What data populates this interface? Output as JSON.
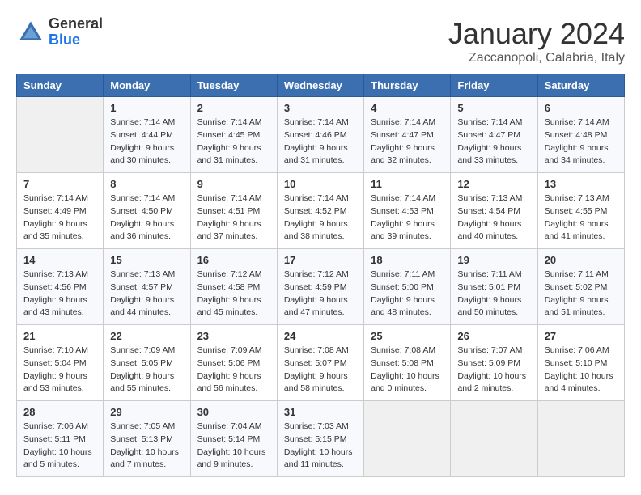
{
  "header": {
    "logo": {
      "general": "General",
      "blue": "Blue"
    },
    "title": "January 2024",
    "location": "Zaccanopoli, Calabria, Italy"
  },
  "weekdays": [
    "Sunday",
    "Monday",
    "Tuesday",
    "Wednesday",
    "Thursday",
    "Friday",
    "Saturday"
  ],
  "weeks": [
    [
      {
        "day": "",
        "info": ""
      },
      {
        "day": "1",
        "info": "Sunrise: 7:14 AM\nSunset: 4:44 PM\nDaylight: 9 hours\nand 30 minutes."
      },
      {
        "day": "2",
        "info": "Sunrise: 7:14 AM\nSunset: 4:45 PM\nDaylight: 9 hours\nand 31 minutes."
      },
      {
        "day": "3",
        "info": "Sunrise: 7:14 AM\nSunset: 4:46 PM\nDaylight: 9 hours\nand 31 minutes."
      },
      {
        "day": "4",
        "info": "Sunrise: 7:14 AM\nSunset: 4:47 PM\nDaylight: 9 hours\nand 32 minutes."
      },
      {
        "day": "5",
        "info": "Sunrise: 7:14 AM\nSunset: 4:47 PM\nDaylight: 9 hours\nand 33 minutes."
      },
      {
        "day": "6",
        "info": "Sunrise: 7:14 AM\nSunset: 4:48 PM\nDaylight: 9 hours\nand 34 minutes."
      }
    ],
    [
      {
        "day": "7",
        "info": "Sunrise: 7:14 AM\nSunset: 4:49 PM\nDaylight: 9 hours\nand 35 minutes."
      },
      {
        "day": "8",
        "info": "Sunrise: 7:14 AM\nSunset: 4:50 PM\nDaylight: 9 hours\nand 36 minutes."
      },
      {
        "day": "9",
        "info": "Sunrise: 7:14 AM\nSunset: 4:51 PM\nDaylight: 9 hours\nand 37 minutes."
      },
      {
        "day": "10",
        "info": "Sunrise: 7:14 AM\nSunset: 4:52 PM\nDaylight: 9 hours\nand 38 minutes."
      },
      {
        "day": "11",
        "info": "Sunrise: 7:14 AM\nSunset: 4:53 PM\nDaylight: 9 hours\nand 39 minutes."
      },
      {
        "day": "12",
        "info": "Sunrise: 7:13 AM\nSunset: 4:54 PM\nDaylight: 9 hours\nand 40 minutes."
      },
      {
        "day": "13",
        "info": "Sunrise: 7:13 AM\nSunset: 4:55 PM\nDaylight: 9 hours\nand 41 minutes."
      }
    ],
    [
      {
        "day": "14",
        "info": "Sunrise: 7:13 AM\nSunset: 4:56 PM\nDaylight: 9 hours\nand 43 minutes."
      },
      {
        "day": "15",
        "info": "Sunrise: 7:13 AM\nSunset: 4:57 PM\nDaylight: 9 hours\nand 44 minutes."
      },
      {
        "day": "16",
        "info": "Sunrise: 7:12 AM\nSunset: 4:58 PM\nDaylight: 9 hours\nand 45 minutes."
      },
      {
        "day": "17",
        "info": "Sunrise: 7:12 AM\nSunset: 4:59 PM\nDaylight: 9 hours\nand 47 minutes."
      },
      {
        "day": "18",
        "info": "Sunrise: 7:11 AM\nSunset: 5:00 PM\nDaylight: 9 hours\nand 48 minutes."
      },
      {
        "day": "19",
        "info": "Sunrise: 7:11 AM\nSunset: 5:01 PM\nDaylight: 9 hours\nand 50 minutes."
      },
      {
        "day": "20",
        "info": "Sunrise: 7:11 AM\nSunset: 5:02 PM\nDaylight: 9 hours\nand 51 minutes."
      }
    ],
    [
      {
        "day": "21",
        "info": "Sunrise: 7:10 AM\nSunset: 5:04 PM\nDaylight: 9 hours\nand 53 minutes."
      },
      {
        "day": "22",
        "info": "Sunrise: 7:09 AM\nSunset: 5:05 PM\nDaylight: 9 hours\nand 55 minutes."
      },
      {
        "day": "23",
        "info": "Sunrise: 7:09 AM\nSunset: 5:06 PM\nDaylight: 9 hours\nand 56 minutes."
      },
      {
        "day": "24",
        "info": "Sunrise: 7:08 AM\nSunset: 5:07 PM\nDaylight: 9 hours\nand 58 minutes."
      },
      {
        "day": "25",
        "info": "Sunrise: 7:08 AM\nSunset: 5:08 PM\nDaylight: 10 hours\nand 0 minutes."
      },
      {
        "day": "26",
        "info": "Sunrise: 7:07 AM\nSunset: 5:09 PM\nDaylight: 10 hours\nand 2 minutes."
      },
      {
        "day": "27",
        "info": "Sunrise: 7:06 AM\nSunset: 5:10 PM\nDaylight: 10 hours\nand 4 minutes."
      }
    ],
    [
      {
        "day": "28",
        "info": "Sunrise: 7:06 AM\nSunset: 5:11 PM\nDaylight: 10 hours\nand 5 minutes."
      },
      {
        "day": "29",
        "info": "Sunrise: 7:05 AM\nSunset: 5:13 PM\nDaylight: 10 hours\nand 7 minutes."
      },
      {
        "day": "30",
        "info": "Sunrise: 7:04 AM\nSunset: 5:14 PM\nDaylight: 10 hours\nand 9 minutes."
      },
      {
        "day": "31",
        "info": "Sunrise: 7:03 AM\nSunset: 5:15 PM\nDaylight: 10 hours\nand 11 minutes."
      },
      {
        "day": "",
        "info": ""
      },
      {
        "day": "",
        "info": ""
      },
      {
        "day": "",
        "info": ""
      }
    ]
  ]
}
